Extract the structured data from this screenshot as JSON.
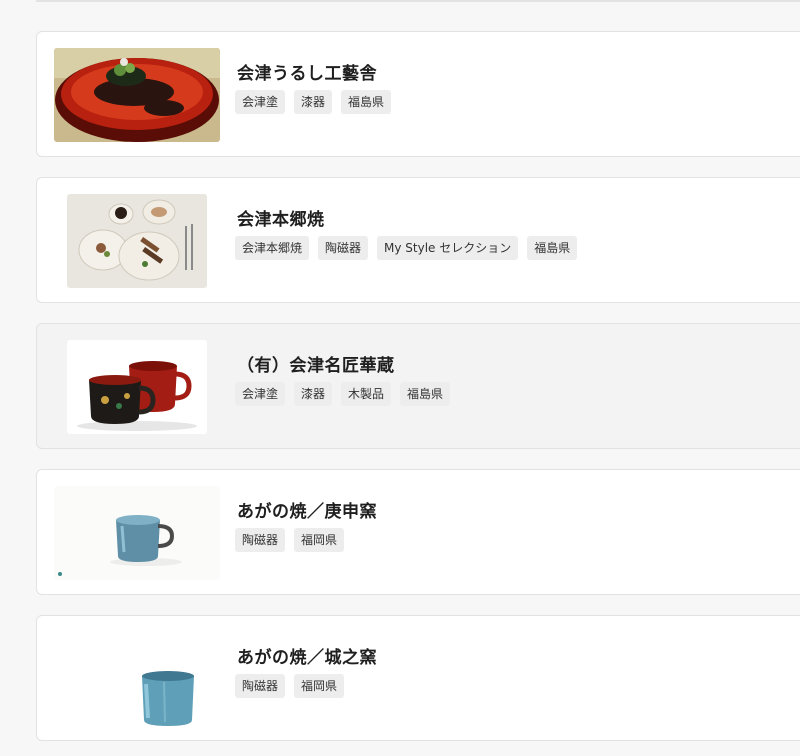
{
  "shops": [
    {
      "title": "会津うるし工藝舎",
      "tags": [
        "会津塗",
        "漆器",
        "福島県"
      ]
    },
    {
      "title": "会津本郷焼",
      "tags": [
        "会津本郷焼",
        "陶磁器",
        "My Style セレクション",
        "福島県"
      ]
    },
    {
      "title": "（有）会津名匠華蔵",
      "tags": [
        "会津塗",
        "漆器",
        "木製品",
        "福島県"
      ]
    },
    {
      "title": "あがの焼／庚申窯",
      "tags": [
        "陶磁器",
        "福岡県"
      ]
    },
    {
      "title": "あがの焼／城之窯",
      "tags": [
        "陶磁器",
        "福岡県"
      ]
    }
  ]
}
